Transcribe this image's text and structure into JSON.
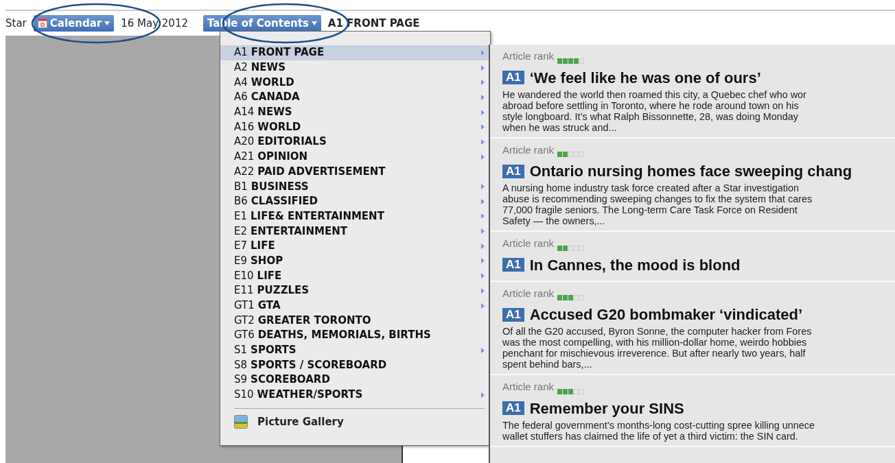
{
  "toolbar": {
    "left_label": "Star",
    "calendar_button": "Calendar",
    "date": "16 May 2012",
    "toc_button": "Table of Contents",
    "current_section": "A1 FRONT PAGE"
  },
  "menu": {
    "items": [
      {
        "code": "A1",
        "name": "FRONT PAGE",
        "selected": true,
        "has_submenu": true
      },
      {
        "code": "A2",
        "name": "NEWS",
        "selected": false,
        "has_submenu": true
      },
      {
        "code": "A4",
        "name": "WORLD",
        "selected": false,
        "has_submenu": true
      },
      {
        "code": "A6",
        "name": "CANADA",
        "selected": false,
        "has_submenu": true
      },
      {
        "code": "A14",
        "name": "NEWS",
        "selected": false,
        "has_submenu": true
      },
      {
        "code": "A16",
        "name": "WORLD",
        "selected": false,
        "has_submenu": true
      },
      {
        "code": "A20",
        "name": "EDITORIALS",
        "selected": false,
        "has_submenu": true
      },
      {
        "code": "A21",
        "name": "OPINION",
        "selected": false,
        "has_submenu": true
      },
      {
        "code": "A22",
        "name": "PAID ADVERTISEMENT",
        "selected": false,
        "has_submenu": false
      },
      {
        "code": "B1",
        "name": "BUSINESS",
        "selected": false,
        "has_submenu": true
      },
      {
        "code": "B6",
        "name": "CLASSIFIED",
        "selected": false,
        "has_submenu": true
      },
      {
        "code": "E1",
        "name": "LIFE& ENTERTAINMENT",
        "selected": false,
        "has_submenu": true
      },
      {
        "code": "E2",
        "name": "ENTERTAINMENT",
        "selected": false,
        "has_submenu": true
      },
      {
        "code": "E7",
        "name": "LIFE",
        "selected": false,
        "has_submenu": true
      },
      {
        "code": "E9",
        "name": "SHOP",
        "selected": false,
        "has_submenu": true
      },
      {
        "code": "E10",
        "name": "LIFE",
        "selected": false,
        "has_submenu": true
      },
      {
        "code": "E11",
        "name": "PUZZLES",
        "selected": false,
        "has_submenu": true
      },
      {
        "code": "GT1",
        "name": "GTA",
        "selected": false,
        "has_submenu": true
      },
      {
        "code": "GT2",
        "name": "GREATER TORONTO",
        "selected": false,
        "has_submenu": false
      },
      {
        "code": "GT6",
        "name": "DEATHS, MEMORIALS, BIRTHS",
        "selected": false,
        "has_submenu": false
      },
      {
        "code": "S1",
        "name": "SPORTS",
        "selected": false,
        "has_submenu": true
      },
      {
        "code": "S8",
        "name": "SPORTS / SCOREBOARD",
        "selected": false,
        "has_submenu": false
      },
      {
        "code": "S9",
        "name": "SCOREBOARD",
        "selected": false,
        "has_submenu": false
      },
      {
        "code": "S10",
        "name": "WEATHER/SPORTS",
        "selected": false,
        "has_submenu": true
      }
    ],
    "gallery": "Picture Gallery"
  },
  "articles": [
    {
      "rank_label": "Article rank",
      "stars": 4,
      "page": "A1",
      "headline": "‘We feel like he was one of ours’",
      "summary": [
        "He wandered the world then roamed this city, a Quebec chef who wor",
        "abroad before settling in Toronto, where he rode around town on his",
        "style longboard. It’s what Ralph Bissonnette, 28, was doing Monday",
        "when he was struck and..."
      ]
    },
    {
      "rank_label": "Article rank",
      "stars": 2,
      "page": "A1",
      "headline": "Ontario nursing homes face sweeping chang",
      "summary": [
        "A nursing home industry task force created after a Star investigation",
        "abuse is recommending sweeping changes to fix the system that cares",
        "77,000 fragile seniors. The Long-term Care Task Force on Resident",
        "Safety — the owners,..."
      ]
    },
    {
      "rank_label": "Article rank",
      "stars": 2,
      "page": "A1",
      "headline": "In Cannes, the mood is blond"
    },
    {
      "rank_label": "Article rank",
      "stars": 3,
      "page": "A1",
      "headline": "Accused G20 bombmaker ‘vindicated’",
      "summary": [
        "Of all the G20 accused, Byron Sonne, the computer hacker from Fores",
        "was the most compelling, with his million-dollar home, weirdo hobbies",
        "penchant for mischievous irreverence. But after nearly two years, half",
        "spent behind bars,..."
      ]
    },
    {
      "rank_label": "Article rank",
      "stars": 3,
      "page": "A1",
      "headline": "Remember your SINS",
      "summary": [
        "The federal government’s months-long cost-cutting spree killing unnece",
        "wallet stuffers has claimed the life of yet a third victim: the SIN card."
      ]
    }
  ]
}
